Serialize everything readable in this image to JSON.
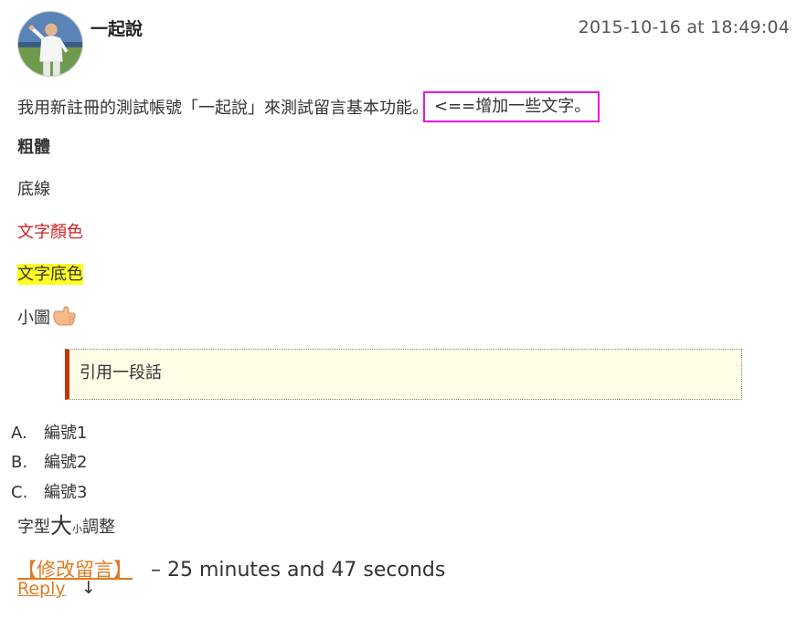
{
  "comment": {
    "author": "一起說",
    "timestamp": "2015-10-16 at 18:49:04",
    "intro_text": "我用新註冊的測試帳號「一起說」來測試留言基本功能。",
    "highlighted_text": "<==增加一些文字。",
    "bold_text": "粗體",
    "underline_text": "底線",
    "color_text": "文字顏色",
    "background_text": "文字底色",
    "small_picture_text": "小圖",
    "quote_text": "引用一段話",
    "list_items": [
      {
        "marker": "A.",
        "label": "編號1"
      },
      {
        "marker": "B.",
        "label": "編號2"
      },
      {
        "marker": "C.",
        "label": "編號3"
      }
    ],
    "font_size_prefix": "字型",
    "font_size_big": "大",
    "font_size_small": "小",
    "font_size_suffix": "調整",
    "edit_link": "【修改留言】",
    "edit_time": "– 25 minutes and 47 seconds",
    "reply_link": "Reply",
    "reply_arrow": "↓"
  },
  "colors": {
    "highlight_border": "#e619e0",
    "red_text": "#d42020",
    "text_background": "#ffff22",
    "quote_bar": "#c0360c",
    "quote_background": "#fffde6",
    "link": "#e07a20"
  },
  "icons": {
    "avatar": "avatar-photo",
    "small_picture": "thumbs-up-icon"
  }
}
